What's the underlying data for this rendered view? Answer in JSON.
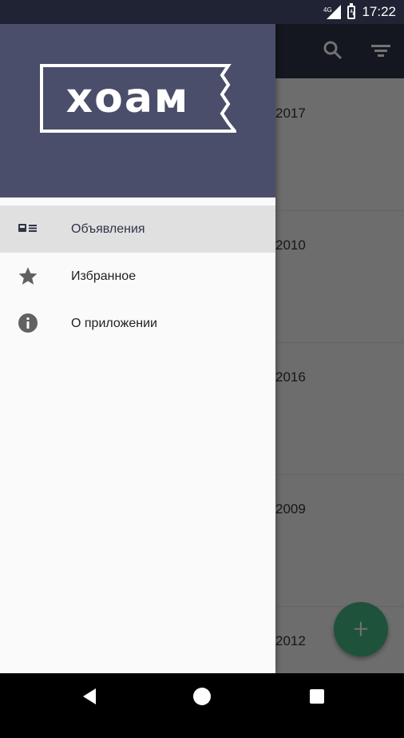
{
  "status_bar": {
    "time": "17:22",
    "network": "4G"
  },
  "app": {
    "years": [
      "2017",
      "2010",
      "2016",
      "2009",
      "2012"
    ],
    "fab_label": "+"
  },
  "drawer": {
    "logo_text": "хоам",
    "menu": [
      {
        "label": "Объявления",
        "icon": "listings-icon",
        "active": true
      },
      {
        "label": "Избранное",
        "icon": "star-icon",
        "active": false
      },
      {
        "label": "О приложении",
        "icon": "info-icon",
        "active": false
      }
    ]
  },
  "colors": {
    "header_bg": "#4a4e6a",
    "appbar_bg": "#2f3447",
    "fab": "#43b581"
  }
}
